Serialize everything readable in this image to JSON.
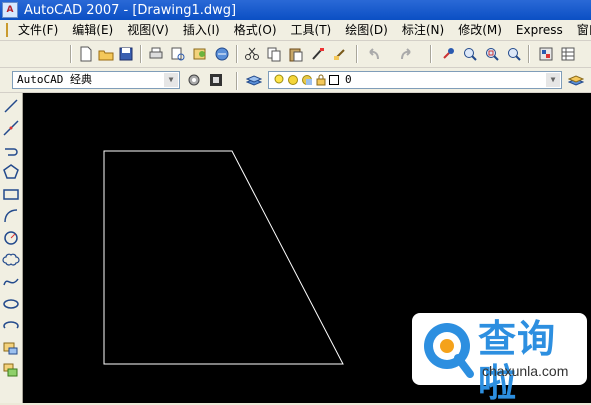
{
  "title": {
    "app_name": "AutoCAD 2007",
    "text": "AutoCAD 2007 - [Drawing1.dwg]"
  },
  "menubar": {
    "items": [
      {
        "label": "文件(F)"
      },
      {
        "label": "编辑(E)"
      },
      {
        "label": "视图(V)"
      },
      {
        "label": "插入(I)"
      },
      {
        "label": "格式(O)"
      },
      {
        "label": "工具(T)"
      },
      {
        "label": "绘图(D)"
      },
      {
        "label": "标注(N)"
      },
      {
        "label": "修改(M)"
      },
      {
        "label": "Express"
      },
      {
        "label": "窗口("
      }
    ]
  },
  "toolbar2": {
    "workspace": "AutoCAD 经典",
    "layer": "0"
  },
  "watermark": {
    "brand": "查询啦",
    "url": "chaxunla.com"
  },
  "colors": {
    "canvas": "#000000",
    "drawing_stroke": "#ffffff",
    "watermark_blue": "#2d8fe0",
    "watermark_orange": "#f5a21b"
  },
  "icons": {
    "toolbar1": [
      "new-icon",
      "open-icon",
      "save-icon",
      "print-icon",
      "preview-icon",
      "publish-icon",
      "plot-icon",
      "cut-icon",
      "copy-icon",
      "paste-icon",
      "matchprop-icon",
      "undo-icon",
      "redo-icon",
      "pan-icon",
      "zoom-realtime-icon",
      "zoom-window-icon",
      "zoom-previous-icon",
      "properties-icon",
      "designcenter-icon",
      "toolpalette-icon"
    ],
    "left_draw": [
      "line-icon",
      "construction-line-icon",
      "polyline-icon",
      "polygon-icon",
      "rectangle-icon",
      "arc-icon",
      "circle-icon",
      "revision-cloud-icon",
      "spline-icon",
      "ellipse-icon",
      "ellipse-arc-icon",
      "insert-block-icon",
      "make-block-icon"
    ]
  }
}
